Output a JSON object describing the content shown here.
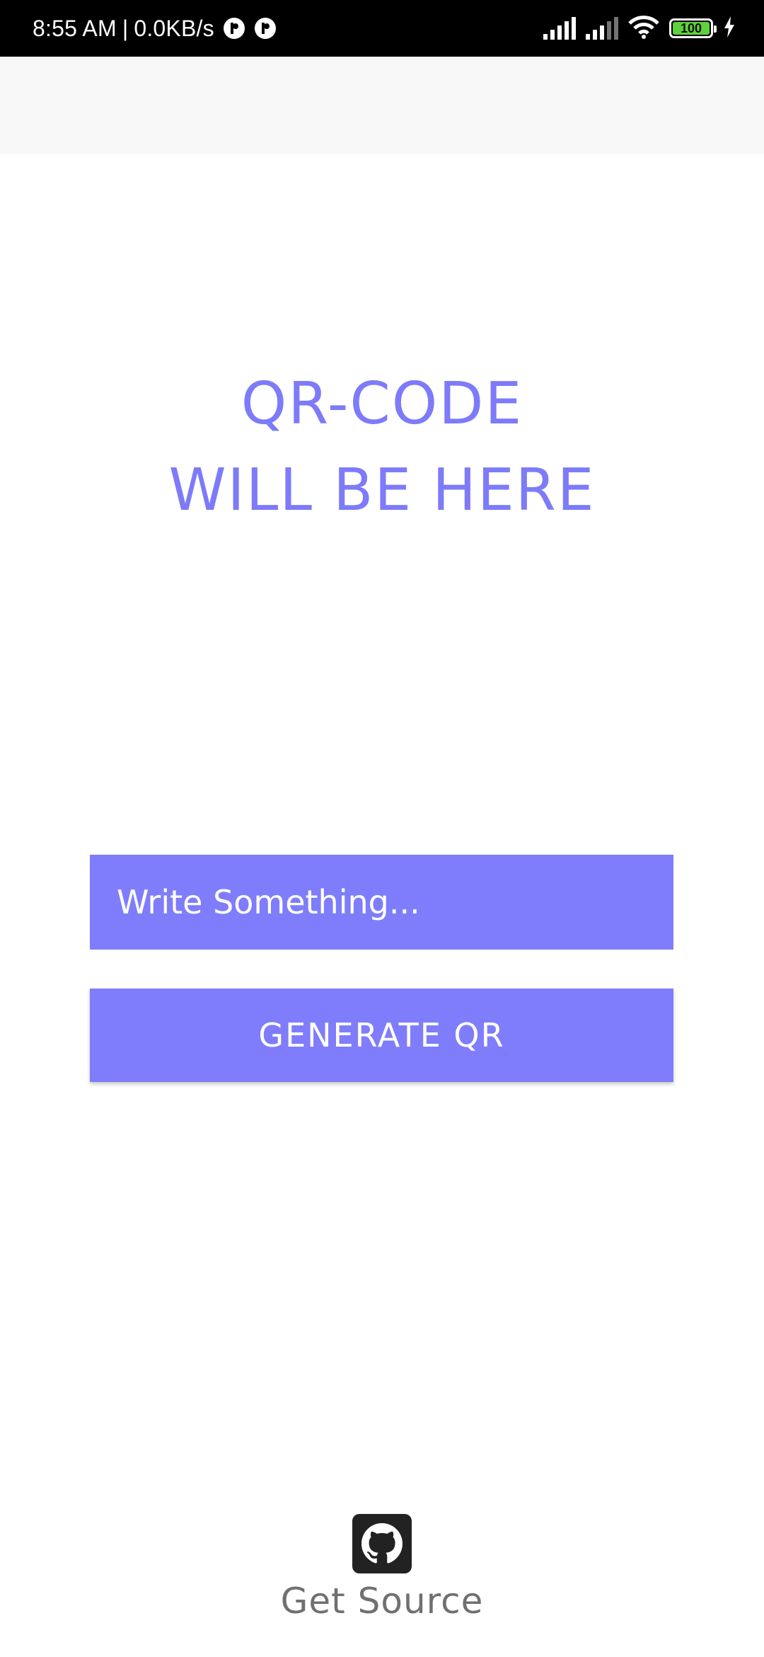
{
  "status_bar": {
    "time": "8:55 AM",
    "separator": "|",
    "network_speed": "0.0KB/s",
    "battery_level": "100",
    "icons": [
      "notification-icon",
      "notification-icon",
      "signal-icon",
      "signal-icon",
      "wifi-icon",
      "battery-icon",
      "charging-icon"
    ]
  },
  "main": {
    "placeholder_line1": "QR-CODE",
    "placeholder_line2": "WILL BE HERE"
  },
  "form": {
    "input_placeholder": "Write Something...",
    "input_value": "",
    "generate_label": "GENERATE QR"
  },
  "footer": {
    "icon": "github-icon",
    "label": "Get Source"
  },
  "colors": {
    "accent": "#7f7dfb",
    "app_bar": "#f8f8f8",
    "footer_text": "#707070"
  }
}
